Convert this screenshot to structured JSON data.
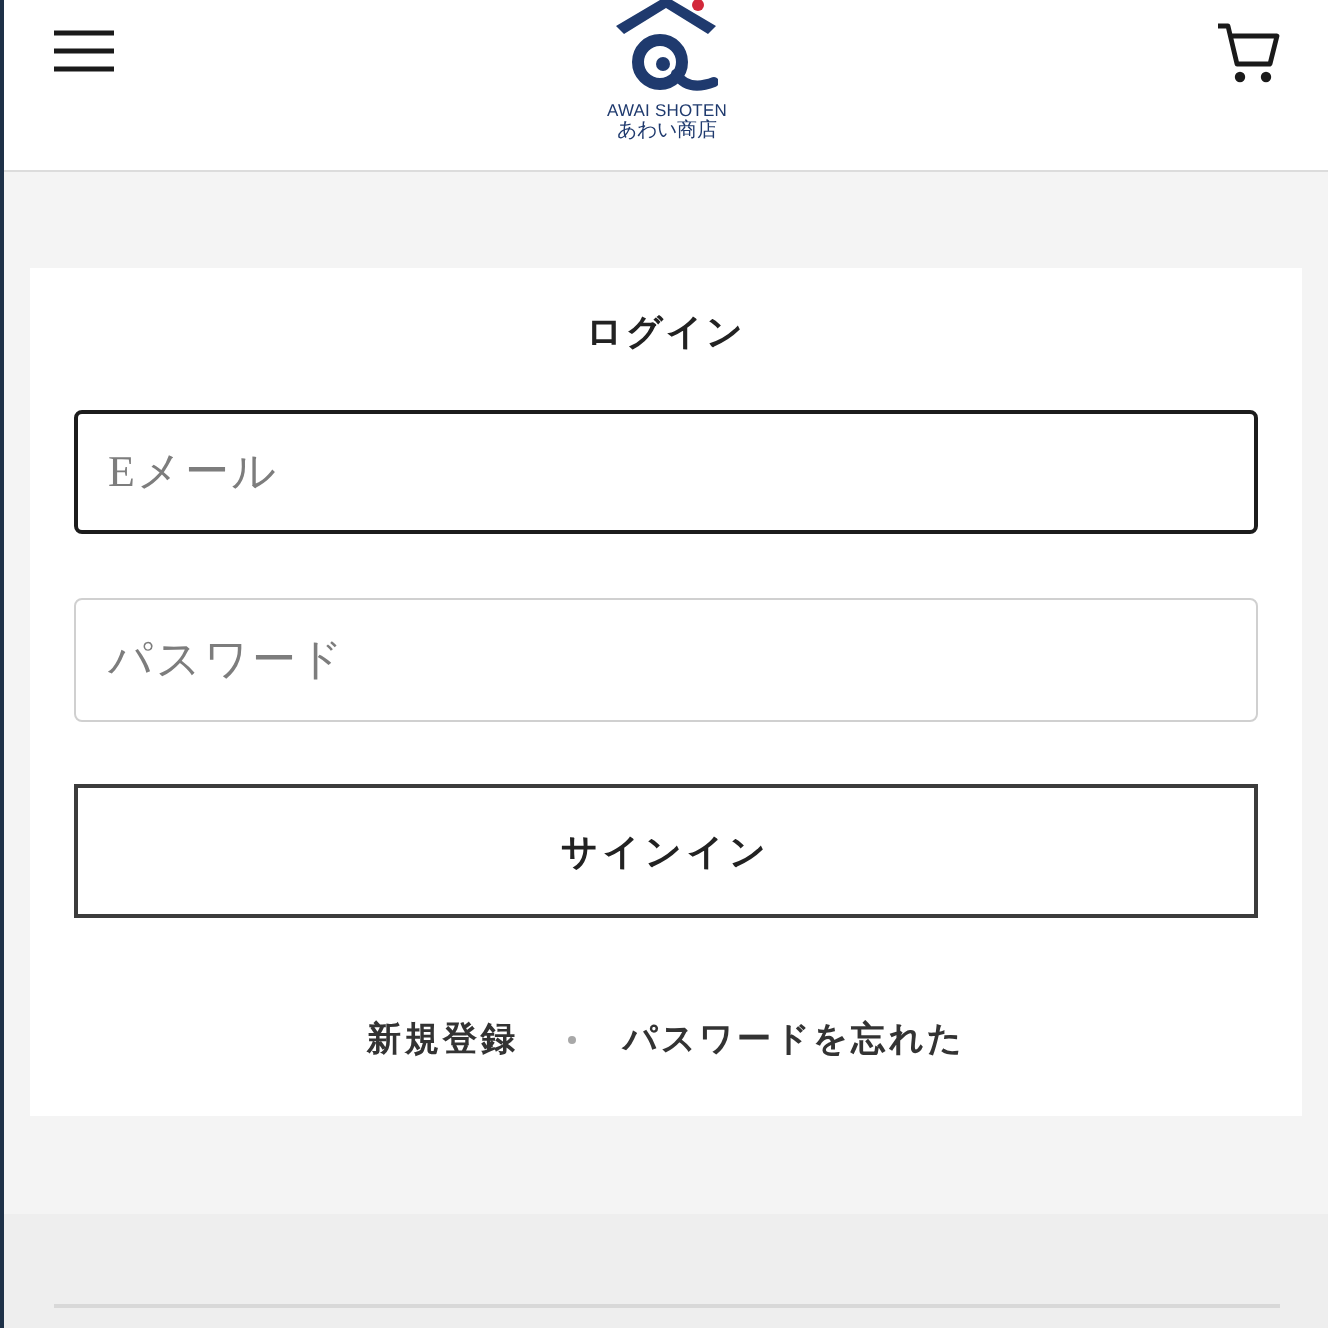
{
  "header": {
    "logo": {
      "name": "AWAI SHOTEN",
      "subtitle": "あわい商店"
    }
  },
  "login": {
    "title": "ログイン",
    "fields": [
      {
        "placeholder": "Eメール",
        "focused": true
      },
      {
        "placeholder": "パスワード",
        "focused": false
      }
    ],
    "submit": "サインイン",
    "links": [
      {
        "label": "新規登録"
      },
      {
        "label": "パスワードを忘れた"
      }
    ]
  }
}
